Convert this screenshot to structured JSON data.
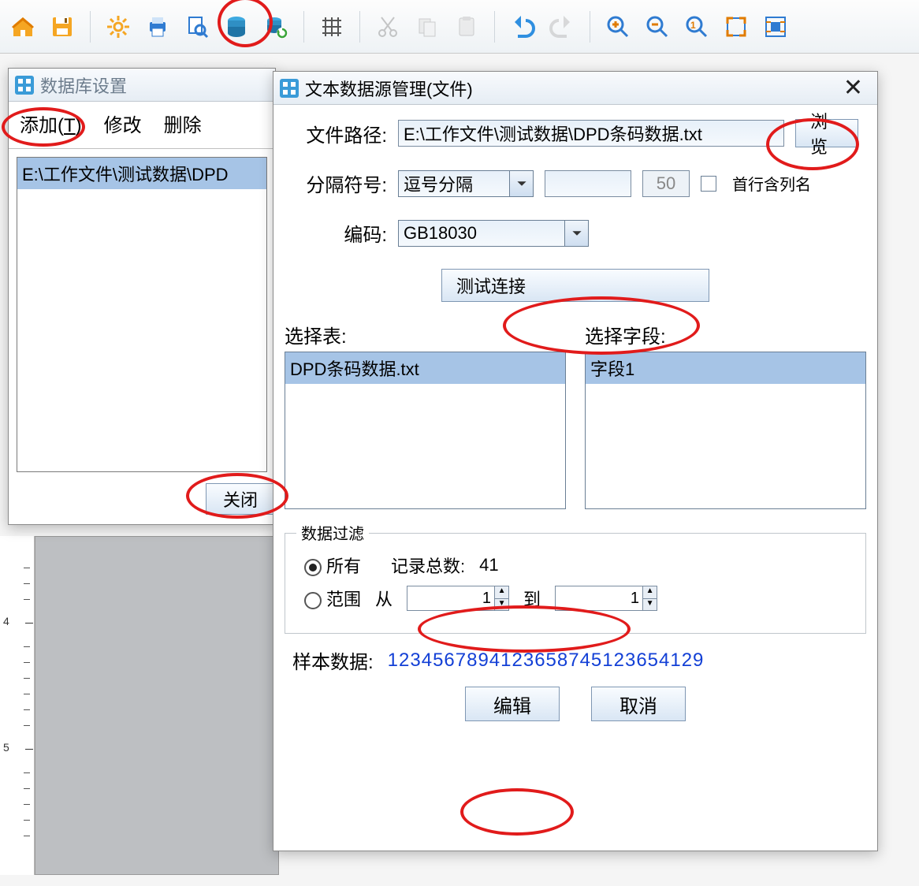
{
  "left_dialog": {
    "title": "数据库设置",
    "actions": {
      "add": "添加(T)",
      "modify": "修改",
      "delete": "删除"
    },
    "list_item": "E:\\工作文件\\测试数据\\DPD",
    "close_btn": "关闭"
  },
  "right_dialog": {
    "title": "文本数据源管理(文件)",
    "labels": {
      "path": "文件路径:",
      "delimiter": "分隔符号:",
      "encoding": "编码:",
      "first_row_header": "首行含列名",
      "select_table": "选择表:",
      "select_field": "选择字段:",
      "filter_legend": "数据过滤",
      "all": "所有",
      "record_total": "记录总数:",
      "range": "范围",
      "from": "从",
      "to": "到",
      "sample": "样本数据:"
    },
    "values": {
      "path": "E:\\工作文件\\测试数据\\DPD条码数据.txt",
      "delimiter": "逗号分隔",
      "delimiter_custom": "",
      "delimiter_num": "50",
      "encoding": "GB18030",
      "table_selected": "DPD条码数据.txt",
      "field_selected": "字段1",
      "record_total": "41",
      "range_from": "1",
      "range_to": "1",
      "sample": "1234567894123658745123654129"
    },
    "buttons": {
      "browse": "浏览",
      "test": "测试连接",
      "edit": "编辑",
      "cancel": "取消"
    }
  }
}
